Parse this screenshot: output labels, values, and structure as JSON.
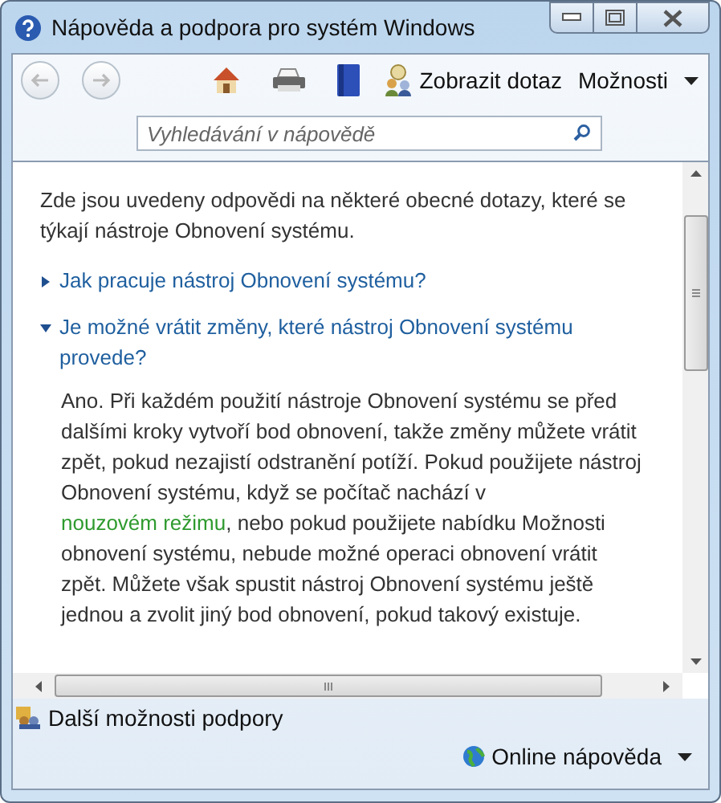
{
  "window": {
    "title": "Nápověda a podpora pro systém Windows"
  },
  "toolbar": {
    "ask_label": "Zobrazit dotaz",
    "options_label": "Možnosti"
  },
  "search": {
    "placeholder": "Vyhledávání v nápovědě"
  },
  "content": {
    "intro": "Zde jsou uvedeny odpovědi na některé obecné dotazy, které se týkají nástroje Obnovení systému.",
    "questions": [
      {
        "title": "Jak pracuje nástroj Obnovení systému?",
        "expanded": false
      },
      {
        "title": "Je možné vrátit změny, které nástroj Obnovení systému provede?",
        "expanded": true,
        "answer": {
          "before": "Ano. Při každém použití nástroje Obnovení systému se před dalšími kroky vytvoří bod obnovení, takže změny můžete vrátit zpět, pokud nezajistí odstranění potíží. Pokud použijete nástroj Obnovení systému, když se počítač nachází v",
          "link": "nouzovém režimu",
          "after": ", nebo pokud použijete nabídku Možnosti obnovení systému, nebude možné operaci obnovení vrátit zpět. Můžete však spustit nástroj Obnovení systému ještě jednou a zvolit jiný bod obnovení, pokud takový existuje."
        }
      }
    ]
  },
  "footer": {
    "support_label": "Další možnosti podpory",
    "online_label": "Online nápověda"
  }
}
